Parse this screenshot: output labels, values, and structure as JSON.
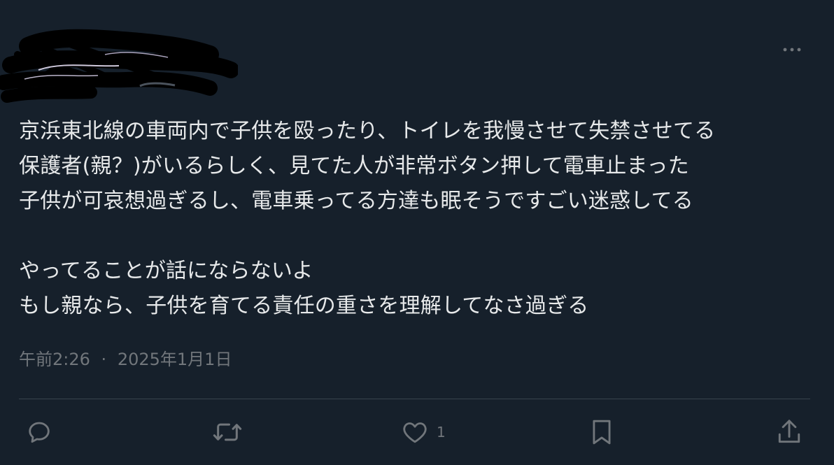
{
  "post": {
    "text": "京浜東北線の車両内で子供を殴ったり、トイレを我慢させて失禁させてる\n保護者(親？)がいるらしく、見てた人が非常ボタン押して電車止まった\n子供が可哀想過ぎるし、電車乗ってる方達も眠そうですごい迷惑してる\n\nやってることが話にならないよ\nもし親なら、子供を育てる責任の重さを理解してなさ過ぎる",
    "time": "午前2:26",
    "separator": "·",
    "date": "2025年1月1日"
  },
  "actions": {
    "reply_icon": "reply-icon",
    "repost_icon": "repost-icon",
    "like_icon": "like-icon",
    "like_count": "1",
    "bookmark_icon": "bookmark-icon",
    "share_icon": "share-icon",
    "more_icon": "more-dots-icon"
  },
  "colors": {
    "background": "#16202b",
    "text": "#e7e9ea",
    "secondary": "#71767b",
    "divider": "#38444d"
  }
}
